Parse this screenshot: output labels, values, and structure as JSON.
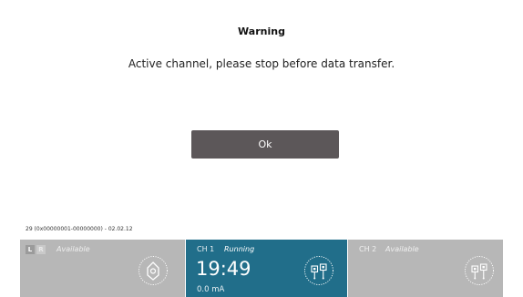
{
  "dialog": {
    "title": "Warning",
    "message": "Active channel, please stop before data transfer.",
    "ok_label": "Ok"
  },
  "device_info": "29 (0x00000001-00000000) - 02.02.12",
  "panels": {
    "lr": {
      "tag_l": "L",
      "tag_r": "R",
      "status": "Available",
      "icon": "electrode-pad-icon"
    },
    "ch1": {
      "label": "CH 1",
      "status": "Running",
      "time": "19:49",
      "current": "0.0 mA",
      "icon": "dual-lead-icon"
    },
    "ch2": {
      "label": "CH 2",
      "status": "Available",
      "icon": "dual-lead-icon"
    }
  },
  "colors": {
    "ok_button": "#5c5759",
    "panel_gray": "#b7b7b7",
    "panel_active": "#216e8a"
  }
}
